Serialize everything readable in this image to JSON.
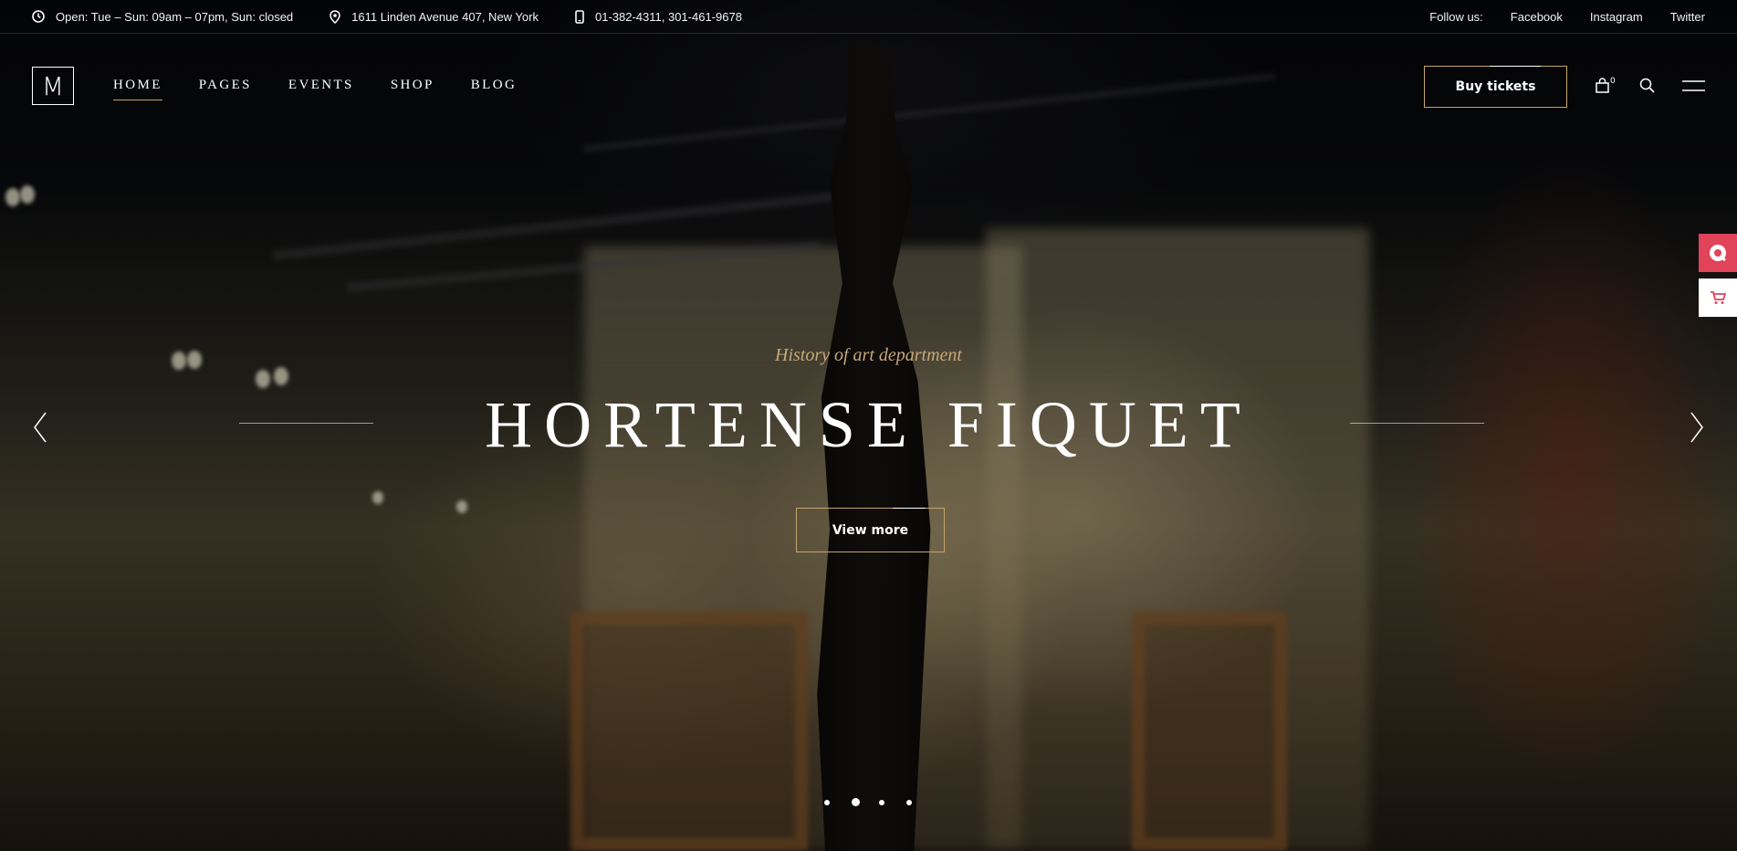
{
  "topbar": {
    "hours": "Open: Tue – Sun: 09am – 07pm, Sun: closed",
    "address": "1611 Linden Avenue 407, New York",
    "phone": "01-382-4311, 301-461-9678",
    "follow_label": "Follow us:",
    "social": [
      "Facebook",
      "Instagram",
      "Twitter"
    ]
  },
  "header": {
    "logo": "M",
    "nav": [
      "HOME",
      "PAGES",
      "EVENTS",
      "SHOP",
      "BLOG"
    ],
    "active_nav": "HOME",
    "buy_tickets": "Buy tickets",
    "cart_count": "0"
  },
  "hero": {
    "subtitle": "History of art department",
    "title": "HORTENSE FIQUET",
    "button": "View more",
    "slides": 4,
    "active_slide": 2
  },
  "colors": {
    "accent_gold": "#c6a46b",
    "side_tab_red": "#e0435a"
  },
  "icons": [
    "clock-icon",
    "location-pin-icon",
    "phone-icon",
    "bag-icon",
    "search-icon",
    "menu-icon",
    "arrow-left-icon",
    "arrow-right-icon",
    "chat-icon",
    "cart-icon"
  ]
}
